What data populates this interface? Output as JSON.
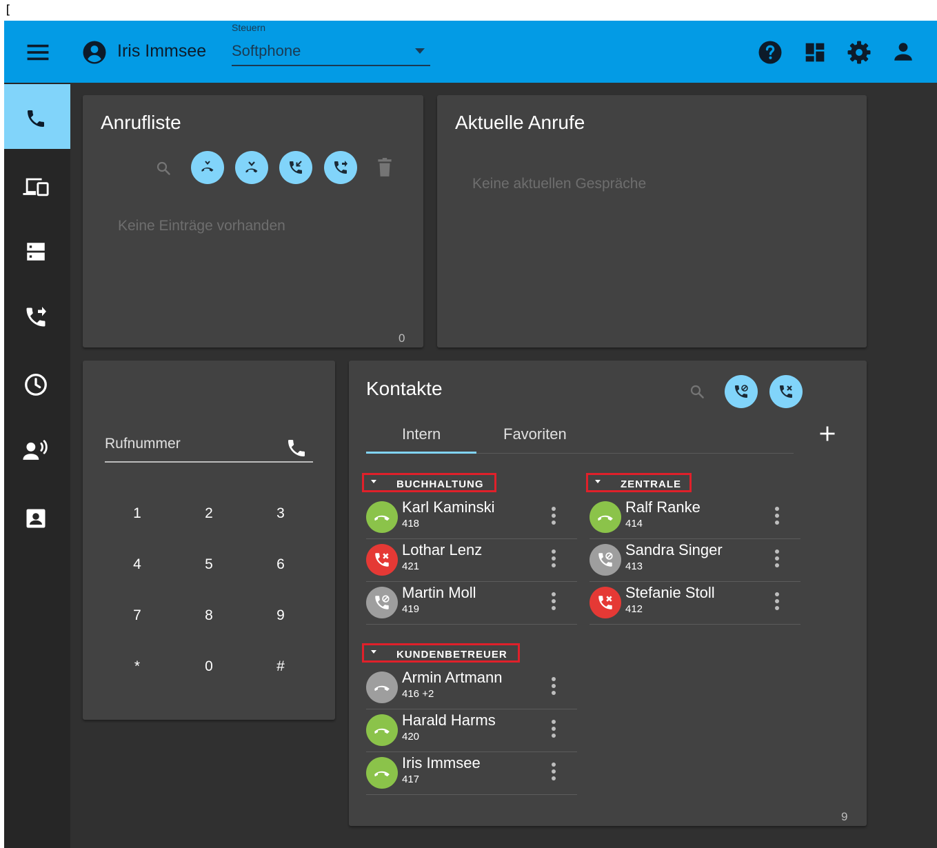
{
  "stray_char": "[",
  "header": {
    "user_name": "Iris Immsee",
    "control_label": "Steuern",
    "control_value": "Softphone"
  },
  "icons": {
    "menu": "menu-icon",
    "user": "account-circle-icon",
    "help": "help-icon",
    "dashboard": "dashboard-icon",
    "settings": "gear-icon",
    "profile": "person-icon"
  },
  "colors": {
    "accent": "#039BE5",
    "accent_light": "#81D4FA",
    "available": "#8BC34A",
    "busy": "#E53935",
    "offline": "#9E9E9E",
    "highlight_border": "#E0202A"
  },
  "call_list": {
    "title": "Anrufliste",
    "empty": "Keine Einträge vorhanden",
    "count": "0"
  },
  "current_calls": {
    "title": "Aktuelle Anrufe",
    "empty": "Keine aktuellen Gespräche"
  },
  "dialpad": {
    "label": "Rufnummer",
    "keys": [
      "1",
      "2",
      "3",
      "4",
      "5",
      "6",
      "7",
      "8",
      "9",
      "*",
      "0",
      "#"
    ]
  },
  "contacts": {
    "title": "Kontakte",
    "tabs": [
      "Intern",
      "Favoriten"
    ],
    "active_tab": "Intern",
    "count": "9",
    "groups": [
      {
        "name": "BUCHHALTUNG",
        "items": [
          {
            "name": "Karl Kaminski",
            "ext": "418",
            "status": "available"
          },
          {
            "name": "Lothar Lenz",
            "ext": "421",
            "status": "busy"
          },
          {
            "name": "Martin Moll",
            "ext": "419",
            "status": "offline"
          }
        ]
      },
      {
        "name": "ZENTRALE",
        "items": [
          {
            "name": "Ralf Ranke",
            "ext": "414",
            "status": "available"
          },
          {
            "name": "Sandra Singer",
            "ext": "413",
            "status": "offline"
          },
          {
            "name": "Stefanie Stoll",
            "ext": "412",
            "status": "busy"
          }
        ]
      },
      {
        "name": "KUNDENBETREUER",
        "items": [
          {
            "name": "Armin Artmann",
            "ext": "416 +2",
            "status": "inactive"
          },
          {
            "name": "Harald Harms",
            "ext": "420",
            "status": "available"
          },
          {
            "name": "Iris Immsee",
            "ext": "417",
            "status": "available"
          }
        ]
      }
    ]
  }
}
